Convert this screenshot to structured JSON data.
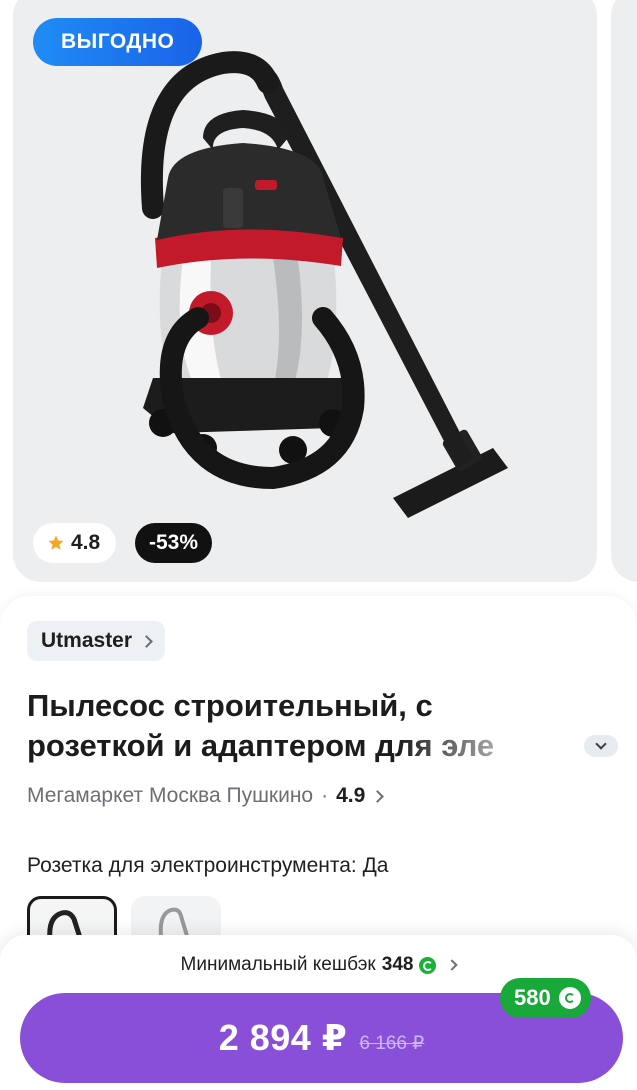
{
  "gallery": {
    "promo_badge": "ВЫГОДНО",
    "rating": "4.8",
    "discount": "-53%"
  },
  "product": {
    "brand": "Utmaster",
    "title_line1": "Пылесос строительный, с",
    "title_line2": "розеткой и адаптером для эле",
    "seller": "Мегамаркет Москва Пушкино",
    "seller_rating": "4.9",
    "feature": "Розетка для электроинструмента: Да"
  },
  "purchase": {
    "cashback_label": "Минимальный кешбэк",
    "cashback_value": "348",
    "price": "2 894 ₽",
    "old_price": "6 166 ₽",
    "bonus": "580"
  },
  "colors": {
    "accent": "#8a4fd9",
    "promo": "#1a73ec",
    "bonus_green": "#19a83a"
  }
}
